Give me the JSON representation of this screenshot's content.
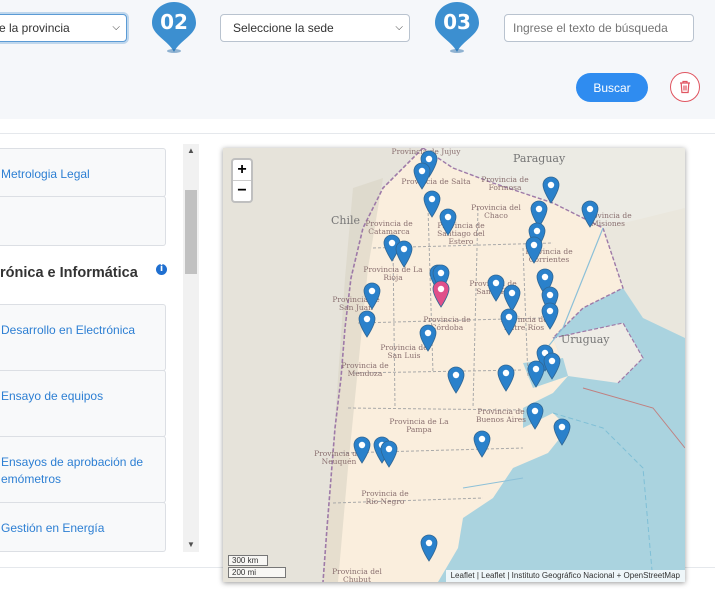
{
  "filters": {
    "province_select": "e la provincia",
    "sede_select": "Seleccione la sede",
    "search_placeholder": "Ingrese el texto de búsqueda",
    "step2": "02",
    "step3": "03",
    "search_button": "Buscar"
  },
  "list": {
    "items": [
      {
        "label": "Metrologia Legal"
      },
      {
        "label": ""
      }
    ],
    "group_title": "rónica e Informática",
    "group_items": [
      {
        "label": "Desarrollo en Electrónica"
      },
      {
        "label": "Ensayo de equipos"
      },
      {
        "label": "Ensayos de aprobación de\nemómetros"
      },
      {
        "label": "Gestión en Energía"
      }
    ]
  },
  "map": {
    "zoom_in": "+",
    "zoom_out": "−",
    "scale_km": "300 km",
    "scale_mi": "200 mi",
    "attribution": "Leaflet | Leaflet | Instituto Geográfico Nacional + OpenStreetMap",
    "countries": {
      "paraguay": "Paraguay",
      "chile": "Chile",
      "uruguay": "Uruguay"
    },
    "province_labels": [
      "Provincia de Jujuy",
      "Provincia de Salta",
      "Provincia de Formosa",
      "Provincia del Chaco",
      "Provincia de Misiones",
      "Provincia de Catamarca",
      "Provincia de Santiago del Estero",
      "Provincia de Corrientes",
      "Provincia de La Rioja",
      "Provincia de San Juan",
      "Provincia de Santa Fe",
      "Provincia de Córdoba",
      "Provincia de Entre Ríos",
      "Provincia de San Luis",
      "Provincia de Mendoza",
      "Provincia de Buenos Aires",
      "Provincia de La Pampa",
      "Provincia del Neuquén",
      "Provincia de Río Negro",
      "Provincia del Chubut"
    ],
    "pin_color": "#2a81cb",
    "active_pin_color": "#e0508a"
  }
}
